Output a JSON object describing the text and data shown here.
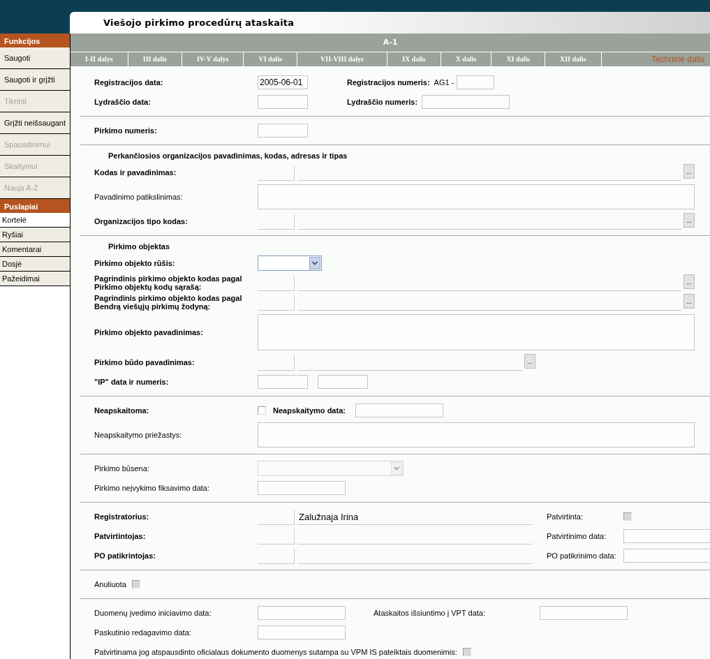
{
  "header": {
    "title": "Viešojo pirkimo procedūrų ataskaita"
  },
  "sidebar": {
    "groups": [
      {
        "title": "Funkcijos",
        "kind": "buttons",
        "items": [
          {
            "label": "Saugoti",
            "disabled": false
          },
          {
            "label": "Saugoti ir grįžti",
            "disabled": false
          },
          {
            "label": "Tikrinti",
            "disabled": true
          },
          {
            "label": "Grįžti neišsaugant",
            "disabled": false
          },
          {
            "label": "Spausdinimui",
            "disabled": true
          },
          {
            "label": "Skaitymui",
            "disabled": true
          },
          {
            "label": "Nauja A-2",
            "disabled": true
          }
        ]
      },
      {
        "title": "Puslapiai",
        "kind": "pages",
        "items": [
          {
            "label": "Kortelė",
            "selected": true
          },
          {
            "label": "Ryšiai",
            "selected": false
          },
          {
            "label": "Komentarai",
            "selected": false
          },
          {
            "label": "Dosjė",
            "selected": false
          },
          {
            "label": "Pažeidimai",
            "selected": false
          }
        ]
      }
    ]
  },
  "form_title": "A-1",
  "tabs": [
    {
      "label": "I-II dalys",
      "selected": false
    },
    {
      "label": "III dalis",
      "selected": false
    },
    {
      "label": "IV-V dalys",
      "selected": false
    },
    {
      "label": "VI dalis",
      "selected": false
    },
    {
      "label": "VII-VIII dalys",
      "selected": false
    },
    {
      "label": "IX dalis",
      "selected": false
    },
    {
      "label": "X dalis",
      "selected": false
    },
    {
      "label": "XI dalis",
      "selected": false
    },
    {
      "label": "XII dalis",
      "selected": false
    },
    {
      "label": "Techninė dalis",
      "selected": true
    }
  ],
  "sections": [
    {
      "kind": "ids",
      "rows": [
        {
          "kind": "standard",
          "label": "Registracijos data:",
          "bold": true,
          "controls": [
            {
              "kind": "short_field",
              "value": "2005-06-01"
            }
          ],
          "side": {
            "label": "Registracijos numeris:",
            "bold": true,
            "controls": [
              {
                "kind": "caption",
                "text": "AG1 -",
                "bold": false
              },
              {
                "kind": "tiny_field"
              }
            ]
          }
        },
        {
          "kind": "standard",
          "label": "Lydraščio data:",
          "bold": true,
          "controls": [
            {
              "kind": "short_field"
            }
          ],
          "side": {
            "label": "Lydraščio numeris:",
            "bold": true,
            "controls": [
              {
                "kind": "field"
              }
            ]
          }
        }
      ]
    },
    {
      "kind": "plain",
      "rows": [
        {
          "kind": "standard",
          "label": "Pirkimo numeris:",
          "bold": true,
          "controls": [
            {
              "kind": "short_field"
            }
          ]
        }
      ]
    },
    {
      "kind": "plain",
      "heading": "Perkančiosios organizacijos pavadinimas, kodas, adresas ir tipas",
      "rows": [
        {
          "kind": "standard",
          "label": "Kodas ir pavadinimas:",
          "bold": true,
          "controls": [
            {
              "kind": "lookup",
              "button": "..."
            }
          ]
        },
        {
          "kind": "standard",
          "label": "Pavadinimo patikslinimas:",
          "bold": false,
          "controls": [
            {
              "kind": "memo"
            }
          ]
        },
        {
          "kind": "standard",
          "label": "Organizacijos tipo kodas:",
          "bold": true,
          "controls": [
            {
              "kind": "lookup",
              "button": "..."
            }
          ]
        }
      ]
    },
    {
      "kind": "plain",
      "heading": "Pirkimo objektas",
      "rows": [
        {
          "kind": "standard",
          "label": "Pirkimo objekto rūšis:",
          "bold": true,
          "controls": [
            {
              "kind": "dropdown",
              "disabled": false
            }
          ]
        },
        {
          "kind": "standard",
          "label": "Pagrindinis pirkimo objekto kodas pagal Pirkimo objektų kodų sąrašą:",
          "bold": true,
          "controls": [
            {
              "kind": "lookup",
              "button": "..."
            }
          ]
        },
        {
          "kind": "standard",
          "label": "Pagrindinis pirkimo objekto kodas pagal Bendrą viešųjų pirkimų žodyną:",
          "bold": true,
          "controls": [
            {
              "kind": "lookup",
              "button": "..."
            }
          ]
        },
        {
          "kind": "standard",
          "label": "Pirkimo objekto pavadinimas:",
          "bold": true,
          "controls": [
            {
              "kind": "big_memo"
            }
          ]
        },
        {
          "kind": "standard",
          "label": "Pirkimo būdo pavadinimas:",
          "bold": true,
          "controls": [
            {
              "kind": "lookup_short",
              "button": "..."
            }
          ]
        },
        {
          "kind": "standard",
          "label": "\"IP\" data ir numeris:",
          "bold": true,
          "controls": [
            {
              "kind": "short_field"
            },
            {
              "kind": "short_field"
            }
          ]
        }
      ]
    },
    {
      "kind": "plain",
      "rows": [
        {
          "kind": "standard",
          "label": "Neapskaitoma:",
          "bold": true,
          "controls": [
            {
              "kind": "checkbox",
              "checked": false,
              "disabled": false
            },
            {
              "kind": "caption",
              "text": "Neapskaitymo data:",
              "bold": true
            },
            {
              "kind": "field"
            }
          ]
        },
        {
          "kind": "standard",
          "label": "Neapskaitymo priežastys:",
          "bold": false,
          "controls": [
            {
              "kind": "memo"
            }
          ]
        }
      ]
    },
    {
      "kind": "plain",
      "rows": [
        {
          "kind": "standard",
          "label": "Pirkimo būsena:",
          "bold": false,
          "controls": [
            {
              "kind": "dropdown",
              "disabled": true
            }
          ]
        },
        {
          "kind": "standard",
          "label": "Pirkimo neįvykimo fiksavimo data:",
          "bold": false,
          "controls": [
            {
              "kind": "field"
            }
          ]
        }
      ]
    },
    {
      "kind": "people",
      "rows": [
        {
          "kind": "standard",
          "label": "Registratorius:",
          "bold": true,
          "controls": [
            {
              "kind": "person",
              "value": "Zalužnaja Irina"
            }
          ],
          "side": {
            "label": "Patvirtinta:",
            "bold": false,
            "controls": [
              {
                "kind": "checkbox",
                "checked": false,
                "disabled": true
              }
            ]
          }
        },
        {
          "kind": "standard",
          "label": "Patvirtintojas:",
          "bold": true,
          "controls": [
            {
              "kind": "person"
            }
          ],
          "side": {
            "label": "Patvirtinimo data:",
            "bold": false,
            "controls": [
              {
                "kind": "field"
              }
            ]
          }
        },
        {
          "kind": "standard",
          "label": "PO patikrintojas:",
          "bold": true,
          "controls": [
            {
              "kind": "person"
            }
          ],
          "side": {
            "label": "PO patikrinimo data:",
            "bold": false,
            "controls": [
              {
                "kind": "field"
              }
            ]
          }
        }
      ]
    },
    {
      "kind": "plain",
      "rows": [
        {
          "kind": "inline",
          "label": "Anuliuota",
          "bold": false,
          "controls": [
            {
              "kind": "checkbox",
              "checked": false,
              "disabled": true
            }
          ]
        }
      ]
    },
    {
      "kind": "dates",
      "rows": [
        {
          "kind": "standard",
          "label": "Duomenų įvedimo iniciavimo data:",
          "bold": false,
          "controls": [
            {
              "kind": "field"
            }
          ],
          "side": {
            "label": "Ataskaitos išsiuntimo į VPT data:",
            "bold": false,
            "controls": [
              {
                "kind": "field"
              }
            ]
          }
        },
        {
          "kind": "standard",
          "label": "Paskutinio redagavimo data:",
          "bold": false,
          "controls": [
            {
              "kind": "field"
            }
          ]
        },
        {
          "kind": "inline",
          "label": "Patvirtinama jog atspausdinto oficialaus dokumento duomenys sutampa su VPM IS pateiktais duomenimis:",
          "bold": false,
          "controls": [
            {
              "kind": "checkbox",
              "checked": false,
              "disabled": true
            }
          ]
        }
      ]
    }
  ]
}
